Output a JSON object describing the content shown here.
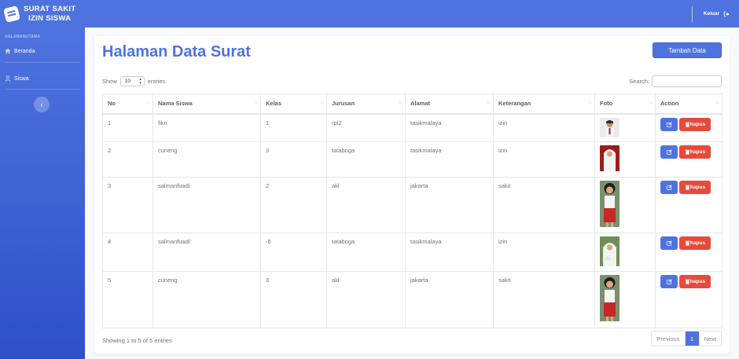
{
  "brand": {
    "line1": "SURAT SAKIT",
    "line2": "IZIN SISWA"
  },
  "topbar": {
    "logout_label": "Keluar",
    "logout_icon": "sign-out-icon"
  },
  "sidebar": {
    "heading": "HALAMANUTAMA",
    "items": [
      {
        "label": "Beranda",
        "icon": "home-icon"
      },
      {
        "label": "Siswa",
        "icon": "user-icon"
      }
    ],
    "toggle_label": "‹"
  },
  "page": {
    "title": "Halaman Data Surat",
    "add_button": "Tambah Data",
    "show_label": "Show",
    "entries_value": "10",
    "entries_label": "entries",
    "search_label": "Search:",
    "search_value": "",
    "info": "Showing 1 to 5 of 5 entries"
  },
  "table": {
    "columns": [
      "No",
      "Nama Siswa",
      "Kelas",
      "Jurusan",
      "Alamat",
      "Keterangan",
      "Foto",
      "Action"
    ],
    "rows": [
      {
        "no": "1",
        "nama": "fikri",
        "kelas": "1",
        "jurusan": "rpl2",
        "alamat": "tasikmalaya",
        "keterangan": "izin"
      },
      {
        "no": "2",
        "nama": "cuneng",
        "kelas": "3",
        "jurusan": "tataboga",
        "alamat": "tasikmalaya",
        "keterangan": "izin"
      },
      {
        "no": "3",
        "nama": "salmanfuadi",
        "kelas": "2",
        "jurusan": "akl",
        "alamat": "jakarta",
        "keterangan": "sakit"
      },
      {
        "no": "4",
        "nama": "salmanfuadi'",
        "kelas": "-6",
        "jurusan": "tataboga",
        "alamat": "tasikmalaya",
        "keterangan": "izin"
      },
      {
        "no": "5",
        "nama": "cuneng",
        "kelas": "3",
        "jurusan": "akl",
        "alamat": "jakarta",
        "keterangan": "sakit"
      }
    ],
    "delete_label": "hapus"
  },
  "pagination": {
    "previous": "Previous",
    "current": "1",
    "next": "Next"
  },
  "colors": {
    "primary": "#4e73df",
    "danger": "#e74a3b"
  }
}
